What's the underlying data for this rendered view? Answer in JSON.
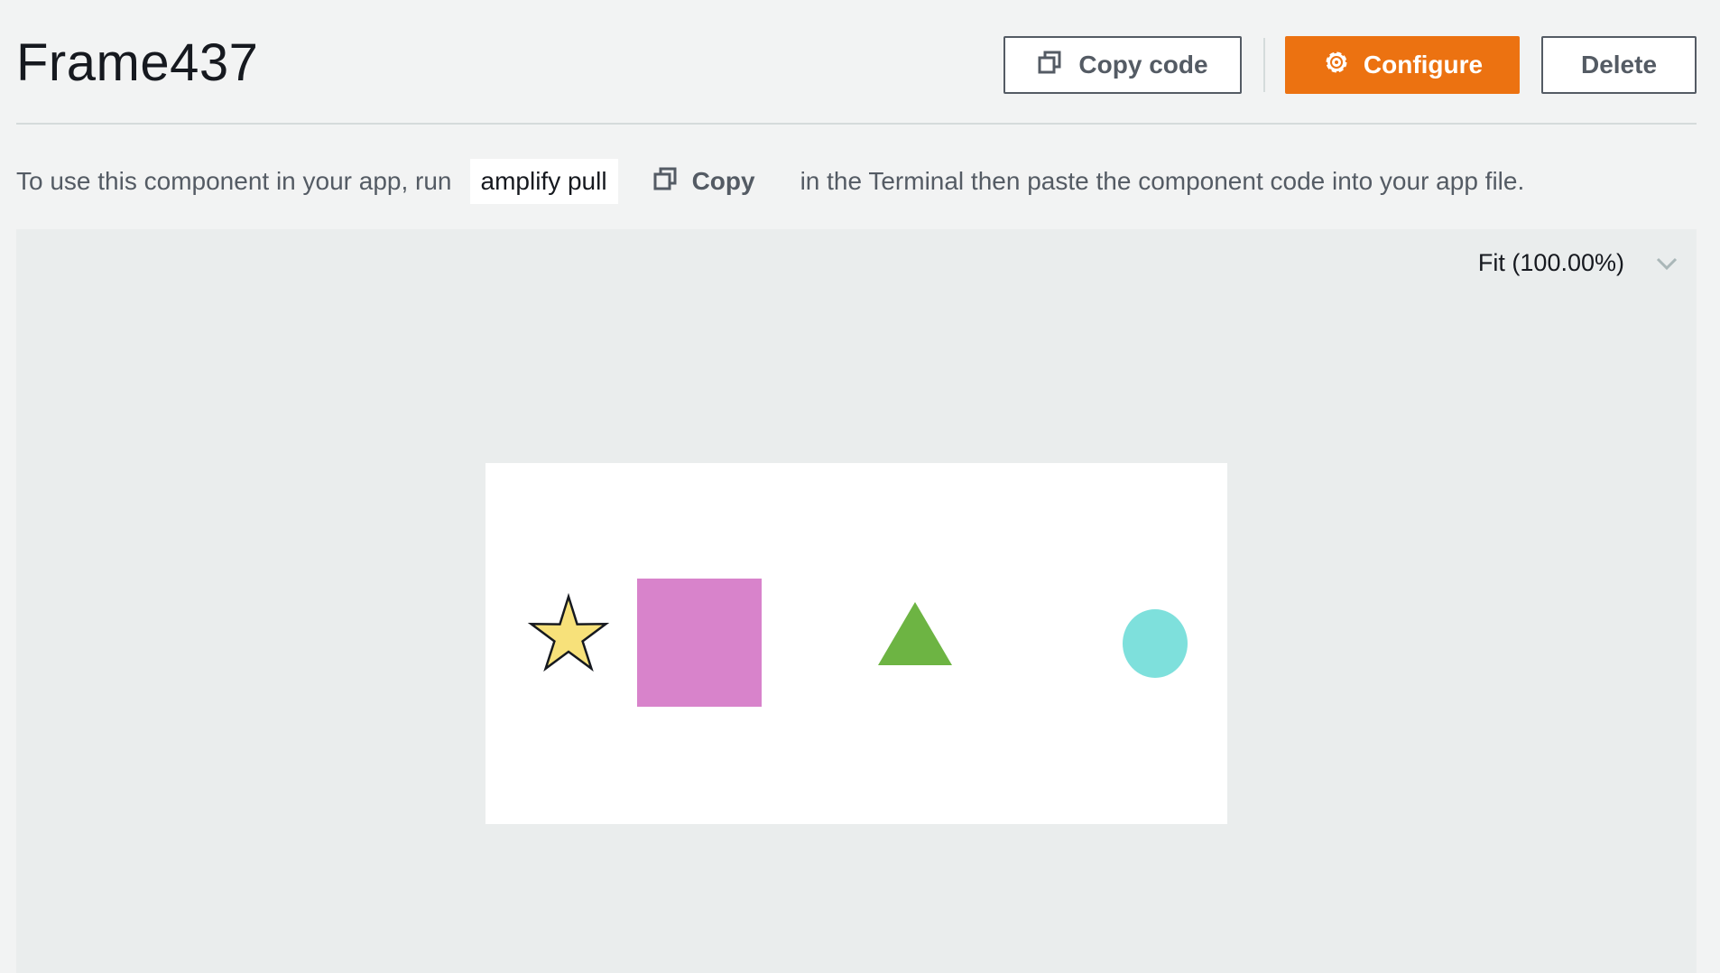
{
  "header": {
    "title": "Frame437",
    "buttons": {
      "copy_code": "Copy code",
      "configure": "Configure",
      "delete": "Delete"
    }
  },
  "instructions": {
    "before": "To use this component in your app, run",
    "command": "amplify pull",
    "copy_label": "Copy",
    "after": "in the Terminal then paste the component code into your app file."
  },
  "preview": {
    "zoom_label": "Fit (100.00%)",
    "shapes": [
      {
        "kind": "star",
        "icon": "star-shape",
        "fill": "#f7e17a",
        "stroke": "#16191f"
      },
      {
        "kind": "square",
        "icon": "square-shape",
        "fill": "#d883cb"
      },
      {
        "kind": "triangle",
        "icon": "triangle-shape",
        "fill": "#6db443"
      },
      {
        "kind": "circle",
        "icon": "circle-shape",
        "fill": "#7ee0dc"
      }
    ]
  },
  "colors": {
    "accent": "#ec7211",
    "text": "#16191f",
    "muted": "#545b64",
    "page_bg": "#f2f3f3",
    "canvas_bg": "#eaeded"
  }
}
